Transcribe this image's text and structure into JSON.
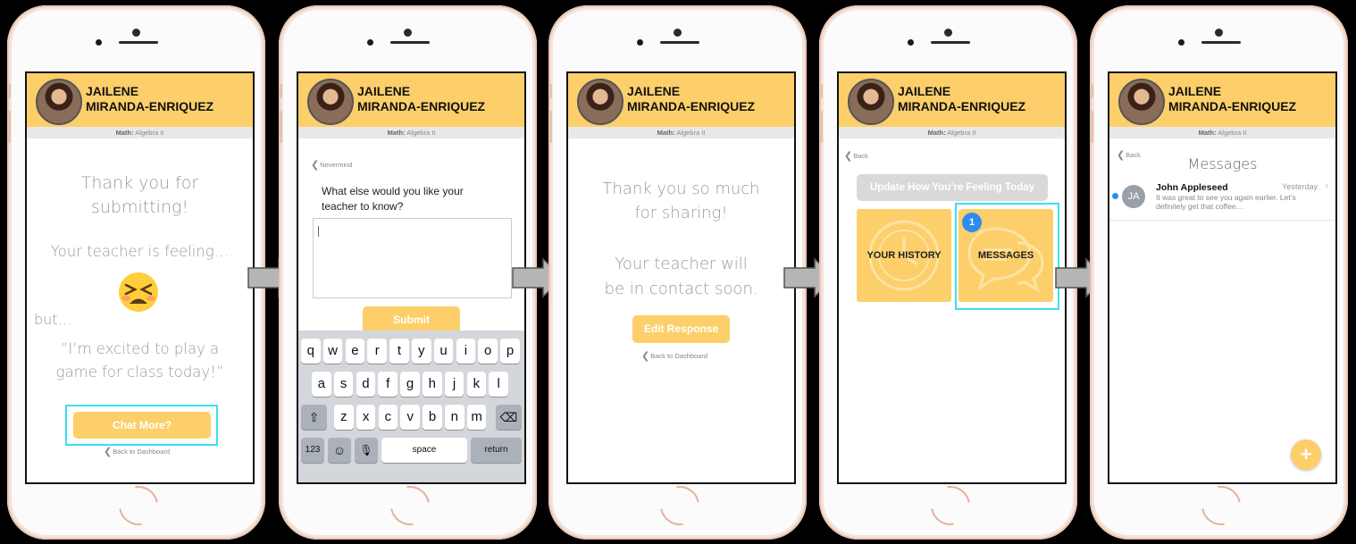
{
  "profile": {
    "name_line1": "JAILENE",
    "name_line2": "MIRANDA-ENRIQUEZ",
    "subject_label": "Math:",
    "subject_value": "Algebra II"
  },
  "screen1": {
    "thanks_line1": "Thank you for",
    "thanks_line2": "submitting!",
    "feeling": "Your teacher is feeling…",
    "but": "but…",
    "quote_line1": "“I’m excited to play a",
    "quote_line2": "game for class today!”",
    "chat_button": "Chat More?",
    "back_link": "Back to Dashboard",
    "emoji_name": "tired-face-emoji"
  },
  "screen2": {
    "back_link": "Nevermind",
    "prompt_line1": "What else would you like your",
    "prompt_line2": "teacher to know?",
    "input_value": "",
    "submit_button": "Submit",
    "keyboard": {
      "row1": [
        "q",
        "w",
        "e",
        "r",
        "t",
        "y",
        "u",
        "i",
        "o",
        "p"
      ],
      "row2": [
        "a",
        "s",
        "d",
        "f",
        "g",
        "h",
        "j",
        "k",
        "l"
      ],
      "row3": [
        "z",
        "x",
        "c",
        "v",
        "b",
        "n",
        "m"
      ],
      "shift": "⇧",
      "delete": "⌫",
      "numbers": "123",
      "emoji": "☺",
      "mic": "🎙",
      "space": "space",
      "return": "return"
    }
  },
  "screen3": {
    "thanks_line1": "Thank you so much",
    "thanks_line2": "for sharing!",
    "contact_line1": "Your teacher will",
    "contact_line2": "be in contact soon.",
    "edit_button": "Edit Response",
    "back_link": "Back to Dashboard"
  },
  "screen4": {
    "back_link": "Back",
    "update_button": "Update How You’re Feeling Today",
    "history_tile": "YOUR HISTORY",
    "messages_tile": "MESSAGES",
    "messages_badge": "1"
  },
  "screen5": {
    "back_link": "Back",
    "title": "Messages",
    "messages": [
      {
        "initials": "JA",
        "sender": "John Appleseed",
        "time": "Yesterday",
        "preview_line1": "It was great to see you again earlier. Let’s",
        "preview_line2": "definitely get that coffee…",
        "unread": true
      }
    ],
    "fab_label": "+"
  },
  "colors": {
    "accent_yellow": "#fccf6a",
    "highlight_cyan": "#39e0ef",
    "badge_blue": "#2e8cf0",
    "muted_gray": "#9a9a9a",
    "background": "#000000"
  }
}
